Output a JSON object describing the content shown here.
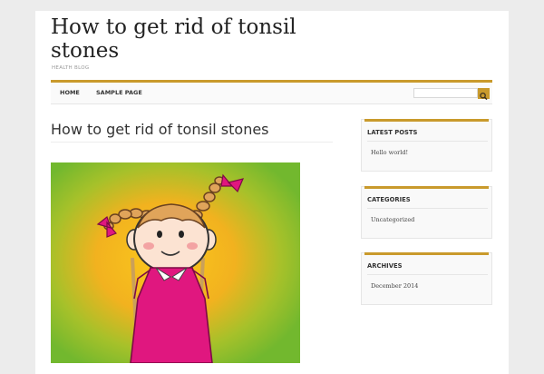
{
  "site": {
    "title": "How to get rid of tonsil stones",
    "description": "HEALTH BLOG"
  },
  "nav": {
    "items": [
      {
        "label": "HOME"
      },
      {
        "label": "SAMPLE PAGE"
      }
    ],
    "search_placeholder": ""
  },
  "post": {
    "title": "How to get rid of tonsil stones"
  },
  "sidebar": {
    "latest_posts": {
      "title": "LATEST POSTS",
      "items": [
        "Hello world!"
      ]
    },
    "categories": {
      "title": "CATEGORIES",
      "items": [
        "Uncategorized"
      ]
    },
    "archives": {
      "title": "ARCHIVES",
      "items": [
        "December 2014"
      ]
    }
  },
  "colors": {
    "accent": "#c99a2c",
    "background": "#ececec",
    "panel": "#ffffff"
  },
  "icons": {
    "search_button": "search-icon"
  }
}
